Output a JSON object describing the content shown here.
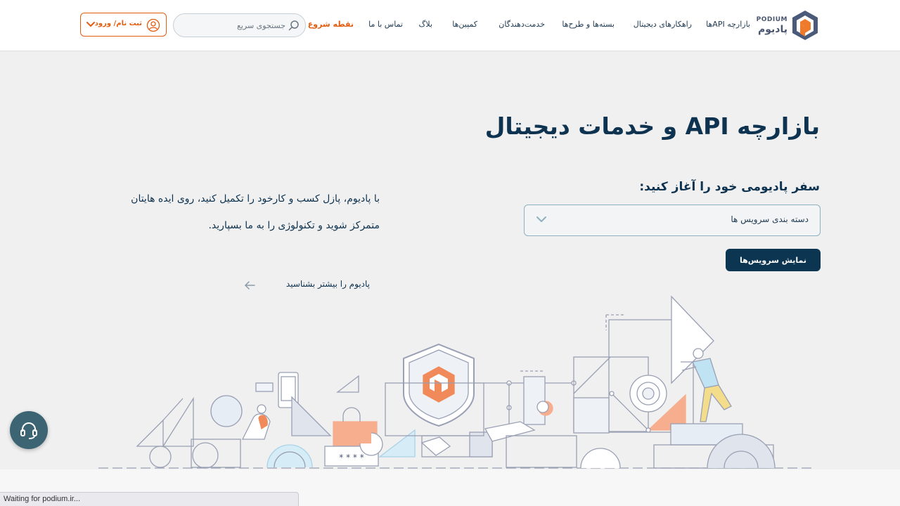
{
  "colors": {
    "primary": "#0b3550",
    "accent": "#e35d10",
    "background": "#f0f0f0",
    "support": "#3d6473"
  },
  "header": {
    "logo_en": "PODIUM",
    "logo_fa": "پادیوم",
    "nav": [
      {
        "label": "بازارچه APIها"
      },
      {
        "label": "راهکارهای دیجیتال"
      },
      {
        "label": "بسته‌ها و طرح‌ها"
      },
      {
        "label": "خدمت‌دهندگان"
      },
      {
        "label": "کمپین‌ها"
      },
      {
        "label": "بلاگ"
      },
      {
        "label": "تماس با ما"
      },
      {
        "label": "نقطه شروع"
      }
    ],
    "search_placeholder": "جستجوی سریع",
    "login_label": "ثبت نام/ ورود"
  },
  "hero": {
    "title": "بازارچه API و خدمات دیجیتال",
    "journey_title": "سفر پادیومی خود را آغاز کنید:",
    "category_select": {
      "selected": "دسته بندی سرویس ها"
    },
    "show_services_label": "نمایش سرویس‌ها",
    "description": "با پادیوم، پازل کسب و کارخود را تکمیل کنید، روی ایده هایتان متمرکز شوید و تکنولوژی را به ما بسپارید.",
    "learn_more_label": "پادیوم را بیشتر بشناسید",
    "badge_code": "* * * *"
  },
  "support": {
    "icon": "headset-icon"
  },
  "status_bar": {
    "text": "Waiting for podium.ir..."
  }
}
